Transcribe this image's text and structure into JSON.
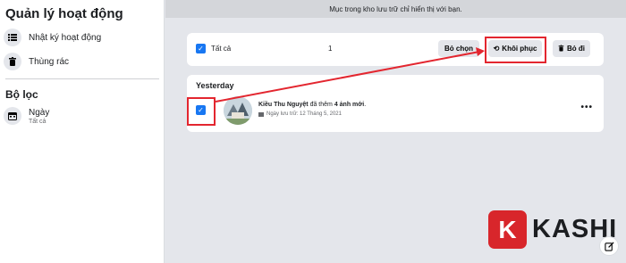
{
  "sidebar": {
    "title": "Quản lý hoạt động",
    "items": [
      {
        "label": "Nhật ký hoạt động",
        "icon": "list-icon"
      },
      {
        "label": "Thùng rác",
        "icon": "trash-icon"
      }
    ],
    "filter_title": "Bộ lọc",
    "filter": {
      "label": "Ngày",
      "sub": "Tất cả",
      "icon": "calendar-icon"
    }
  },
  "topbar": {
    "text": "Mục trong kho lưu trữ chỉ hiển thị với bạn."
  },
  "actions": {
    "select_all_label": "Tất cả",
    "selected_count": "1",
    "deselect_label": "Bỏ chọn",
    "restore_label": "Khôi phục",
    "delete_label": "Bỏ đi"
  },
  "feed": {
    "group_label": "Yesterday",
    "entry": {
      "author": "Kiều Thu Nguyệt",
      "action": " đã thêm ",
      "object": "4 ảnh mới",
      "suffix": ".",
      "meta": "Ngày lưu trữ: 12 Tháng 5, 2021"
    }
  },
  "watermark": {
    "letter": "K",
    "text": "KASHI"
  },
  "colors": {
    "accent": "#1877f2",
    "highlight": "#e3262f",
    "brand": "#d8262b"
  }
}
